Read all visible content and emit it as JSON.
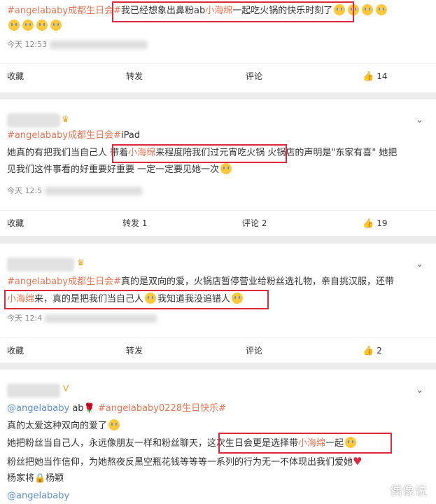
{
  "card1": {
    "text_pre": "#angelababy成都生日会#",
    "text_hl": "我已经想象出鼻粉ab",
    "text_link": "小海绵",
    "text_post": "一起吃火锅的快乐时刻了",
    "time": "今天 12:53",
    "actions": {
      "fav": "收藏",
      "repost": "转发",
      "comment": "评论",
      "like_count": "14"
    }
  },
  "card2": {
    "source_hash": "#angelababy成都生日会#",
    "source_device": "iPad",
    "line1_pre": "她真的有把我们当自己人",
    "line1_box_pre": "带着",
    "line1_link": "小海绵",
    "line1_box_post": "来程度陪我们过元宵吃火锅",
    "line1_post": "火锅店的声明是\"东家有喜\" 她把",
    "line2": "见我们这件事看的好重要好重要 一定一定要见她一次",
    "time": "今天 12:5",
    "actions": {
      "fav": "收藏",
      "repost": "转发 1",
      "comment": "评论 2",
      "like_count": "19"
    }
  },
  "card3": {
    "line1_hash": "#angelababy成都生日会#",
    "line1_text": "真的是双向的爱，火锅店暂停营业给粉丝选礼物，亲自挑汉服，还带",
    "line2_link": "小海绵",
    "line2_text": "来，真的是把我们当自己人",
    "line2_text2": "我知道我没追错人",
    "time": "今天 12:4",
    "actions": {
      "fav": "收藏",
      "repost": "转发",
      "comment": "评论",
      "like_count": "2"
    }
  },
  "card4": {
    "source_user": "@angelababy",
    "source_ab": "ab",
    "source_hash": "#angelababy0228生日快乐#",
    "line1": "真的太爱这种双向的爱了",
    "line2_pre": "她把粉丝当自己人，永远像朋友一样和粉丝聊天，",
    "line2_box": "这次生日会更是选择带",
    "line2_link": "小海绵",
    "line2_box_post": "一起",
    "line3": "粉丝把她当作信仰，为她熬夜反黑空瓶花钱等等等一系列的行为无一不体现出我们爱她",
    "line4_pre": "杨家将",
    "line4_post": "杨颖",
    "line5": "@angelababy"
  },
  "watermark": "偶像说",
  "colors": {
    "accent": "#eb7350",
    "highlight_box": "#e0283c",
    "background": "#ebebeb"
  },
  "icons": [
    "emoji-crying-icon",
    "crown-icon",
    "chevron-down-icon",
    "thumbs-up-icon",
    "heart-icon",
    "lock-icon",
    "rose-icon"
  ]
}
